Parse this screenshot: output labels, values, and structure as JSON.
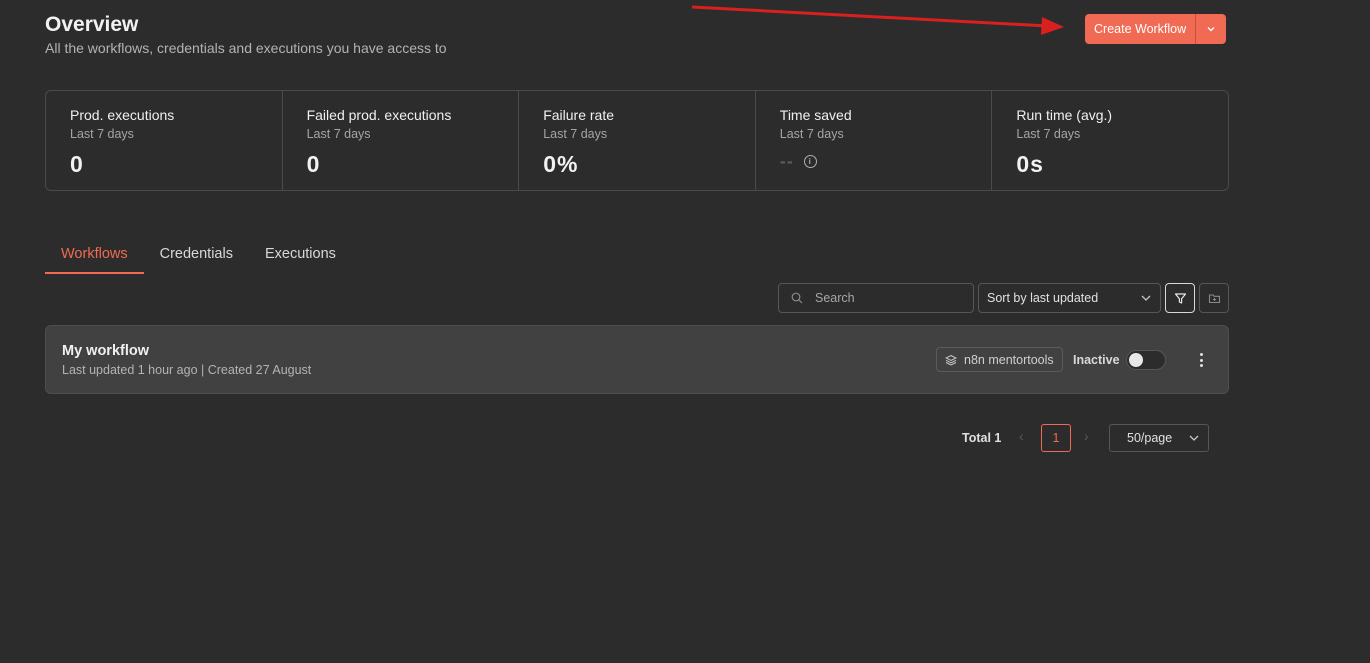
{
  "header": {
    "title": "Overview",
    "subtitle": "All the workflows, credentials and executions you have access to",
    "create_label": "Create Workflow"
  },
  "stats": [
    {
      "label": "Prod. executions",
      "sub": "Last 7 days",
      "value": "0"
    },
    {
      "label": "Failed prod. executions",
      "sub": "Last 7 days",
      "value": "0"
    },
    {
      "label": "Failure rate",
      "sub": "Last 7 days",
      "value": "0%"
    },
    {
      "label": "Time saved",
      "sub": "Last 7 days",
      "value": "--"
    },
    {
      "label": "Run time (avg.)",
      "sub": "Last 7 days",
      "value": "0s"
    }
  ],
  "tabs": [
    {
      "label": "Workflows",
      "active": true
    },
    {
      "label": "Credentials",
      "active": false
    },
    {
      "label": "Executions",
      "active": false
    }
  ],
  "toolbar": {
    "search_placeholder": "Search",
    "sort_value": "Sort by last updated"
  },
  "workflow": {
    "name": "My workflow",
    "meta": "Last updated 1 hour ago | Created 27 August",
    "project": "n8n mentortools",
    "status": "Inactive"
  },
  "pagination": {
    "total": "Total 1",
    "current": "1",
    "per_page": "50/page"
  },
  "colors": {
    "accent": "#f16a53",
    "background": "#2b2c2b",
    "card": "#414141",
    "annotation_arrow": "#d9201f"
  },
  "icons": {
    "search": "search-icon",
    "chevron": "chevron-down-icon",
    "filter": "filter-icon",
    "folder": "folder-icon",
    "project": "layers-icon",
    "info": "info-icon",
    "menu": "kebab-menu-icon"
  }
}
